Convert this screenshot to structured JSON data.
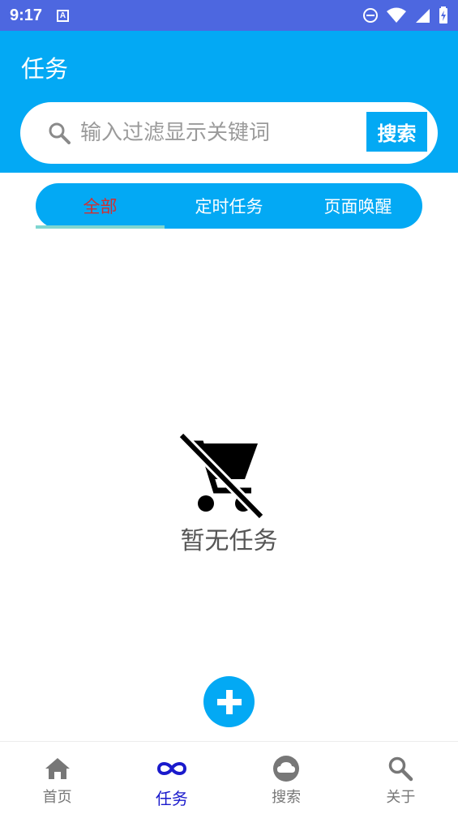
{
  "status_bar": {
    "time": "9:17",
    "notification_glyph": "A"
  },
  "header": {
    "title": "任务"
  },
  "search": {
    "placeholder": "输入过滤显示关键词",
    "value": "",
    "button_label": "搜索"
  },
  "tabs": [
    {
      "label": "全部",
      "active": true
    },
    {
      "label": "定时任务",
      "active": false
    },
    {
      "label": "页面唤醒",
      "active": false
    }
  ],
  "empty_state": {
    "icon": "remove-shopping-cart-icon",
    "text": "暂无任务"
  },
  "fab": {
    "icon": "plus-icon"
  },
  "bottom_nav": [
    {
      "label": "首页",
      "icon": "home-icon",
      "active": false
    },
    {
      "label": "任务",
      "icon": "infinity-icon",
      "active": true
    },
    {
      "label": "搜索",
      "icon": "cloud-icon",
      "active": false
    },
    {
      "label": "关于",
      "icon": "search-icon",
      "active": false
    }
  ],
  "colors": {
    "status_bar": "#4d67e0",
    "primary": "#03a9f4",
    "active_tab_text": "#d32f2f",
    "active_nav": "#1a1acc",
    "inactive_nav": "#777777"
  }
}
